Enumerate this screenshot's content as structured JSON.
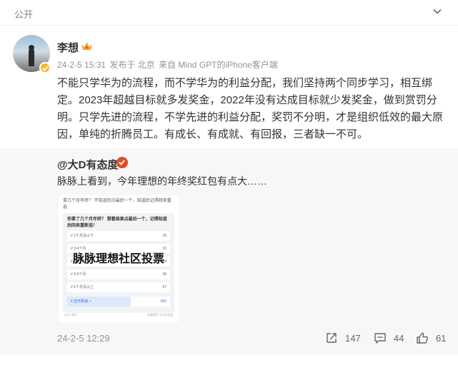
{
  "header": {
    "visibility": "公开"
  },
  "author": {
    "name": "李想"
  },
  "meta": {
    "timestamp": "24-2-5 15:31",
    "location": "发布于 北京",
    "source": "来自 Mind GPT的iPhone客户端"
  },
  "post": {
    "lines": [
      "不能只学华为的流程，而不学华为的利益分配，我们坚持两个同步学习，相互绑",
      "定。2023年超越目标就多发奖金，2022年没有达成目标就少发奖金，做到赏罚分",
      "明。只学先进的流程，不学先进的利益分配，奖罚不分明，才是组织低效的最大原",
      "因，单纯的折腾员工。有成长、有成就、有回报，三者缺一不可。"
    ]
  },
  "repost": {
    "user": "@大D有态度",
    "text": "脉脉上看到，今年理想的年终奖红包有点大……",
    "time": "24-2-5 12:29",
    "image": {
      "header": "拿几个月年终？ 不知道的点最后一个，知道后记得回来重选",
      "question": "你拿了几个月年终？ 想看结果点最后一个，记得知道后回来重新选！",
      "watermark": "脉脉理想社区投票",
      "footer_left": "282人参与",
      "footer_right": "@微博主-大D有态度",
      "options": [
        {
          "label": "# 2个月及以下",
          "count": "25"
        },
        {
          "label": "# 3-4个月",
          "count": "16"
        },
        {
          "label": "# 4-5个月",
          "count": "34"
        },
        {
          "label": "# 4-5个月",
          "count": "38"
        },
        {
          "label": "# 5个月及以上",
          "count": "97"
        },
        {
          "label": "# 还不知道 ✓",
          "count": "435",
          "selected": true,
          "share": 0.62
        }
      ]
    }
  },
  "actions": {
    "share": "147",
    "comment": "44",
    "like": "61"
  }
}
